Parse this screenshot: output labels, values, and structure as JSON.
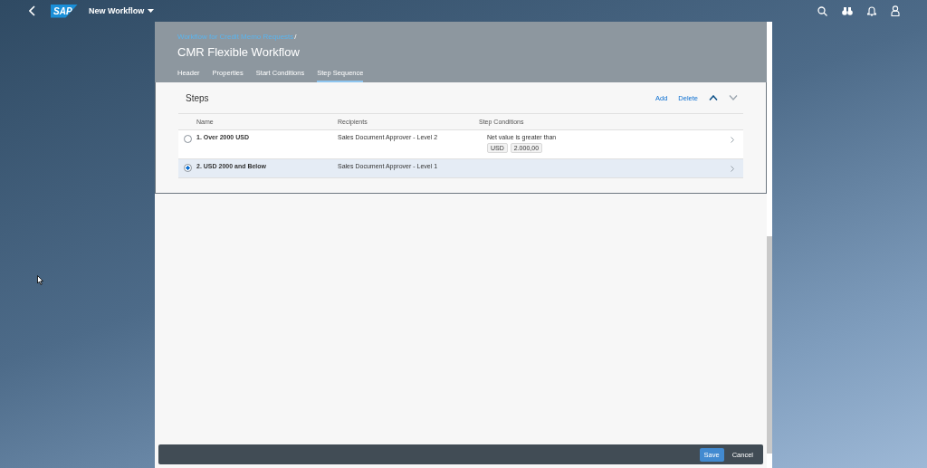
{
  "shell": {
    "logo": "SAP",
    "title": "New Workflow"
  },
  "breadcrumb": {
    "link": "Workflow for Credit Memo Requests",
    "separator": "/"
  },
  "page_title": "CMR Flexible Workflow",
  "tabs": [
    {
      "label": "Header",
      "selected": false
    },
    {
      "label": "Properties",
      "selected": false
    },
    {
      "label": "Start Conditions",
      "selected": false
    },
    {
      "label": "Step Sequence",
      "selected": true
    }
  ],
  "steps": {
    "title": "Steps",
    "actions": [
      "Add",
      "Delete"
    ],
    "columns": [
      "Name",
      "Recipients",
      "Step Conditions"
    ],
    "rows": [
      {
        "name": "1. Over 2000 USD",
        "recipients": "Sales Document Approver - Level 2",
        "condition": "Net value is greater than",
        "tokens": [
          "USD",
          "2.000,00"
        ],
        "selected": false
      },
      {
        "name": "2. USD 2000 and Below",
        "recipients": "Sales Document Approver - Level 1",
        "tokens": [],
        "selected": true
      }
    ]
  },
  "footer": {
    "buttons": [
      {
        "label": "Save",
        "kind": "primary"
      },
      {
        "label": "Cancel",
        "kind": "transparent"
      }
    ]
  }
}
